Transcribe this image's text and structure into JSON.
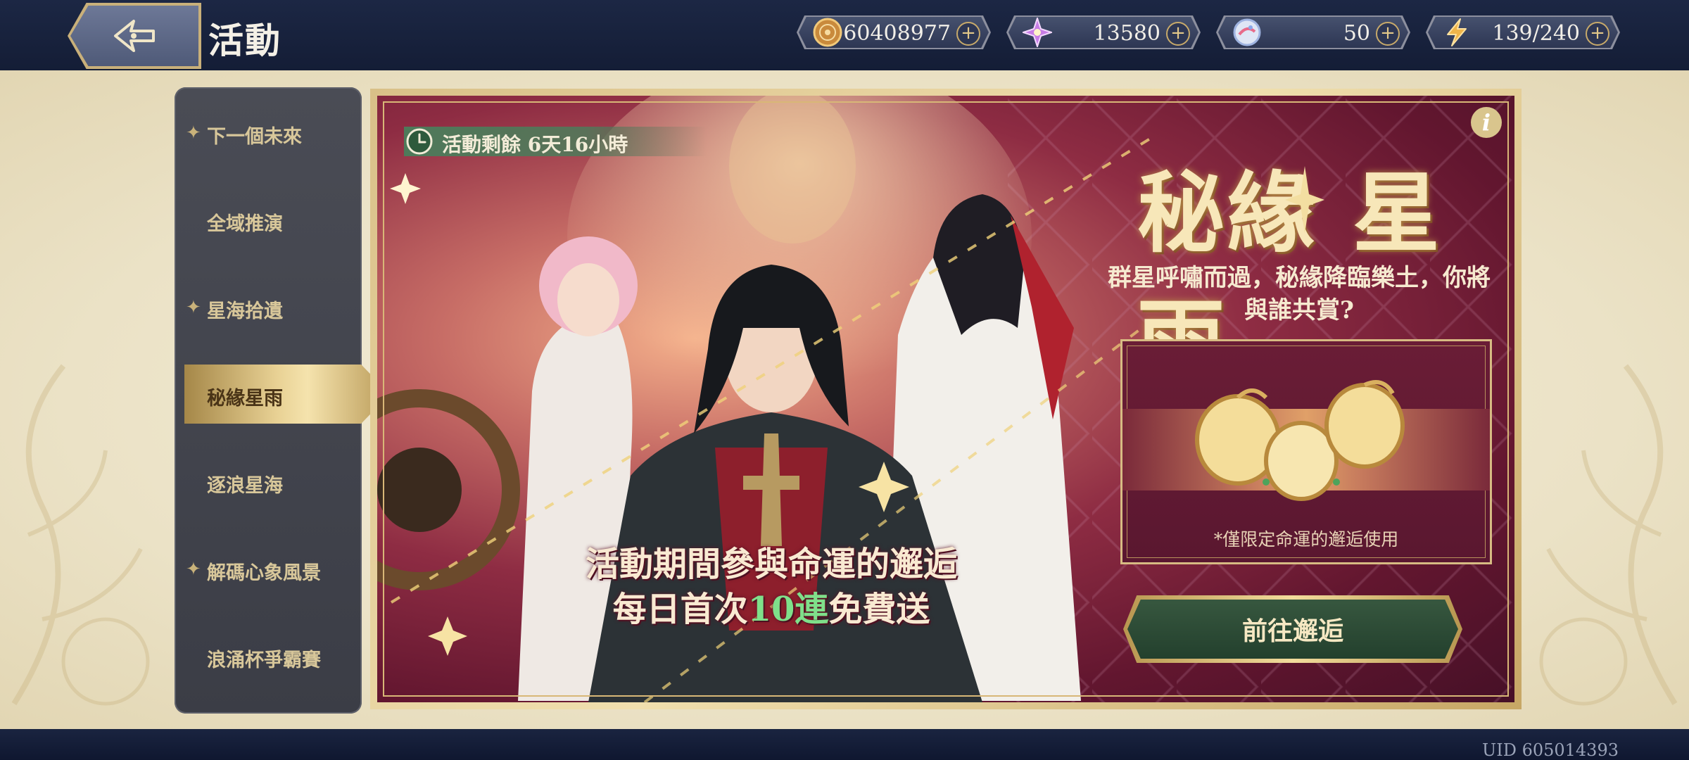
{
  "header": {
    "title": "活動",
    "back_icon": "back-arrow-icon",
    "resources": [
      {
        "icon": "gold-coin-icon",
        "value": "60408977"
      },
      {
        "icon": "star-crystal-icon",
        "value": "13580"
      },
      {
        "icon": "orb-ticket-icon",
        "value": "50"
      },
      {
        "icon": "stamina-bolt-icon",
        "value": "139/240"
      }
    ],
    "plus_label": "+"
  },
  "sidebar": {
    "items": [
      {
        "label": "下一個未來",
        "star": true,
        "active": false
      },
      {
        "label": "全域推演",
        "star": false,
        "active": false
      },
      {
        "label": "星海拾遺",
        "star": true,
        "active": false
      },
      {
        "label": "秘緣星雨",
        "star": false,
        "active": true
      },
      {
        "label": "逐浪星海",
        "star": false,
        "active": false
      },
      {
        "label": "解碼心象風景",
        "star": true,
        "active": false
      },
      {
        "label": "浪涌杯爭霸賽",
        "star": false,
        "active": false
      }
    ],
    "star_glyph": "✦"
  },
  "banner": {
    "timer_text": "活動剩餘 6天16小時",
    "info_label": "i",
    "title_part1": "秘緣",
    "title_part2": "星雨",
    "subtitle": "群星呼嘯而過，秘緣降臨樂土，你將與誰共賞?",
    "promo_line1": "活動期間參與命運的邂逅",
    "promo_line2_pre": "每日首次",
    "promo_line2_hl": "10連",
    "promo_line2_post": "免費送",
    "reward_note": "*僅限定命運的邂逅使用",
    "go_button": "前往邂逅"
  },
  "footer": {
    "uid": "UID 605014393"
  },
  "colors": {
    "topbar": "#1c2744",
    "gold": "#d9c088",
    "banner_red": "#8e2c43",
    "button_green": "#37573f",
    "highlight_green": "#7fe08a"
  }
}
